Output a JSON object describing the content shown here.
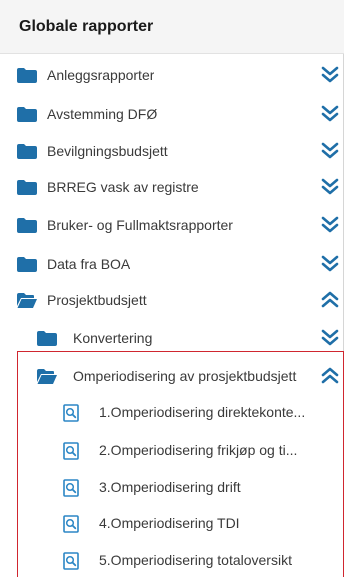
{
  "header": {
    "title": "Globale rapporter"
  },
  "folders": [
    {
      "label": "Anleggsrapporter",
      "state": "collapsed"
    },
    {
      "label": "Avstemming DFØ",
      "state": "collapsed"
    },
    {
      "label": "Bevilgningsbudsjett",
      "state": "collapsed"
    },
    {
      "label": "BRREG vask av registre",
      "state": "collapsed"
    },
    {
      "label": "Bruker- og Fullmaktsrapporter",
      "state": "collapsed"
    },
    {
      "label": "Data fra BOA",
      "state": "collapsed"
    },
    {
      "label": "Prosjektbudsjett",
      "state": "expanded"
    }
  ],
  "subfolders": [
    {
      "label": "Konvertering",
      "state": "collapsed"
    },
    {
      "label": "Omperiodisering av prosjektbudsjett",
      "state": "expanded"
    }
  ],
  "reports": [
    {
      "label": "1.Omperiodisering direktekonte..."
    },
    {
      "label": "2.Omperiodisering frikjøp og ti..."
    },
    {
      "label": "3.Omperiodisering drift"
    },
    {
      "label": "4.Omperiodisering TDI"
    },
    {
      "label": "5.Omperiodisering totaloversikt"
    }
  ],
  "icons": {
    "folder_closed": "folder-icon",
    "folder_open": "folder-open-icon",
    "expand": "double-chevron-down-icon",
    "collapse": "double-chevron-up-icon",
    "report": "report-search-icon"
  },
  "colors": {
    "folder": "#1f6fa8",
    "chevron": "#1f6fa8",
    "report_icon": "#2b86c5",
    "highlight_border": "#d0262f",
    "header_bg": "#f5f5f5"
  }
}
